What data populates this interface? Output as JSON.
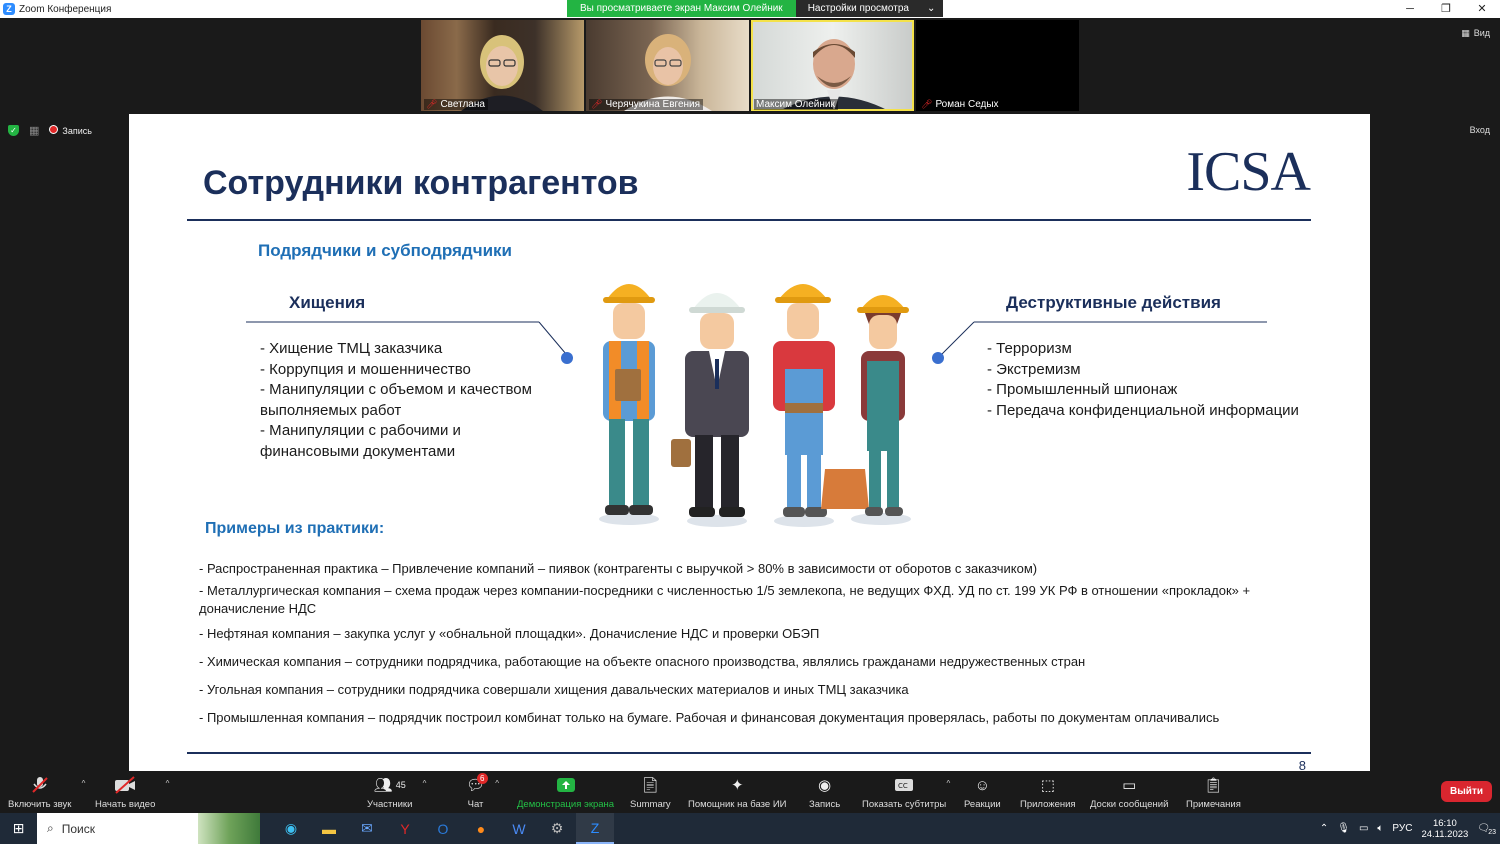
{
  "window": {
    "title": "Zoom Конференция",
    "controls": [
      "─",
      "❐",
      "✕"
    ]
  },
  "share_banner": {
    "viewing": "Вы просматриваете экран Максим Олейник",
    "settings": "Настройки просмотра"
  },
  "participants_tiles": [
    {
      "name": "Светлана",
      "muted": true
    },
    {
      "name": "Черячукина Евгения",
      "muted": true
    },
    {
      "name": "Максим Олейник",
      "muted": false
    },
    {
      "name": "Роман Седых",
      "muted": true
    }
  ],
  "view_button": "Вид",
  "enter_button": "Вход",
  "status": {
    "record_label": "Запись"
  },
  "slide": {
    "title": "Сотрудники контрагентов",
    "logo": "ICSA",
    "subheading": "Подрядчики и субподрядчики",
    "left_heading": "Хищения",
    "left_items": [
      "- Хищение ТМЦ заказчика",
      "- Коррупция и мошенничество",
      "- Манипуляции с объемом и качеством",
      "выполняемых работ",
      "- Манипуляции с рабочими и",
      "финансовыми документами"
    ],
    "right_heading": "Деструктивные действия",
    "right_items": [
      "- Терроризм",
      "- Экстремизм",
      "- Промышленный шпионаж",
      "- Передача конфиденциальной информации"
    ],
    "examples_heading": "Примеры из практики:",
    "examples": [
      "- Распространенная практика – Привлечение компаний – пиявок (контрагенты с выручкой > 80% в зависимости от оборотов с заказчиком)",
      "- Металлургическая компания – схема продаж через компании-посредники с численностью 1/5 землекопа, не ведущих ФХД. УД по ст. 199 УК РФ в отношении «прокладок» + доначисление НДС",
      "- Нефтяная компания – закупка услуг у «обнальной площадки». Доначисление НДС и проверки ОБЭП",
      "- Химическая компания – сотрудники подрядчика, работающие на объекте опасного производства, являлись гражданами недружественных стран",
      "- Угольная компания – сотрудники подрядчика совершали хищения давальческих материалов и иных ТМЦ заказчика",
      "- Промышленная компания – подрядчик построил комбинат только на бумаге. Рабочая и финансовая документация проверялась, работы по документам оплачивались"
    ],
    "page_number": "8"
  },
  "toolbar": {
    "unmute": "Включить звук",
    "start_video": "Начать видео",
    "participants": "Участники",
    "participants_count": "45",
    "chat": "Чат",
    "chat_badge": "6",
    "share": "Демонстрация экрана",
    "summary": "Summary",
    "ai": "Помощник на базе ИИ",
    "record": "Запись",
    "captions": "Показать субтитры",
    "reactions": "Реакции",
    "apps": "Приложения",
    "whiteboards": "Доски сообщений",
    "notes": "Примечания",
    "leave": "Выйти"
  },
  "taskbar": {
    "search_placeholder": "Поиск",
    "lang": "РУС",
    "time": "16:10",
    "date": "24.11.2023",
    "notif_count": "23"
  },
  "colors": {
    "slide_title": "#1b2f5b",
    "accent_blue": "#1f6fb5",
    "zoom_green": "#23b443",
    "leave_red": "#d9262f"
  }
}
